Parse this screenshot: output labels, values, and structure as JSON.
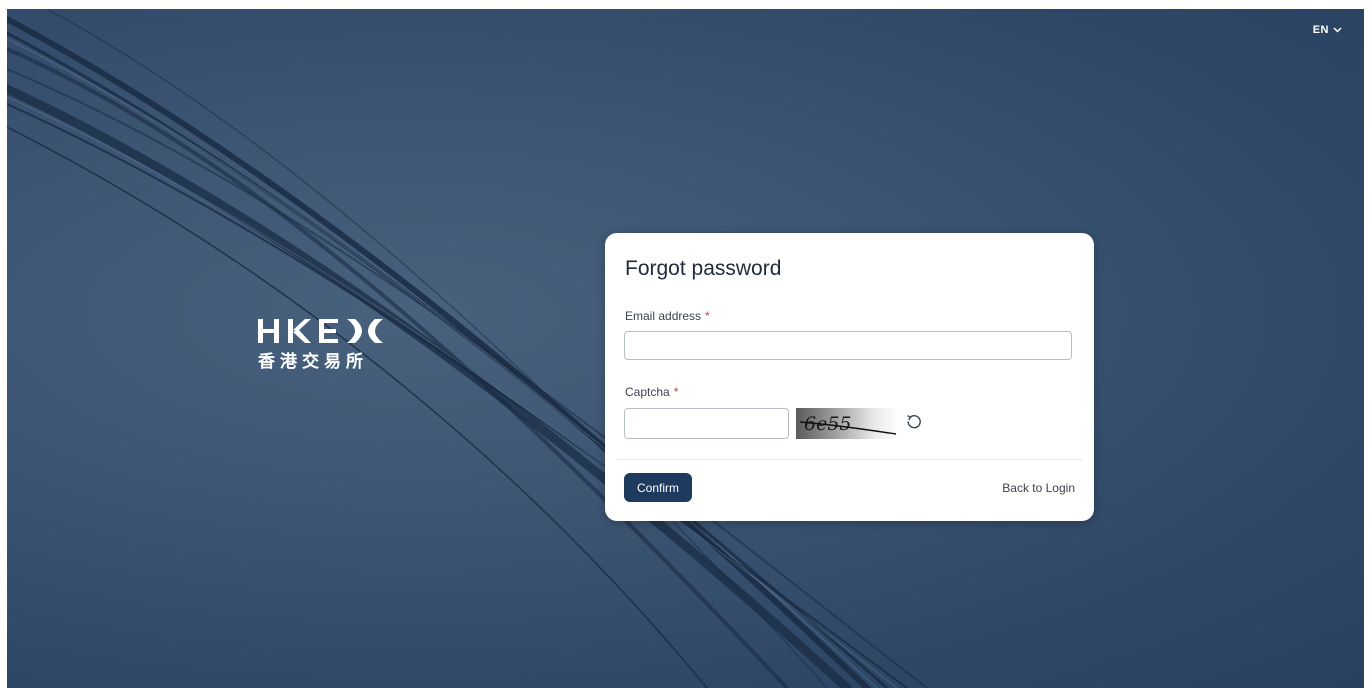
{
  "header": {
    "language": "EN"
  },
  "brand": {
    "logo_text": "HKEX",
    "logo_chinese": "香港交易所"
  },
  "form": {
    "title": "Forgot password",
    "email": {
      "label": "Email address",
      "required_mark": "*",
      "value": "",
      "placeholder": ""
    },
    "captcha": {
      "label": "Captcha",
      "required_mark": "*",
      "value": "",
      "placeholder": "",
      "image_text": "6e55"
    },
    "confirm_label": "Confirm",
    "back_label": "Back to Login"
  },
  "icons": {
    "language_caret": "chevron-down-icon",
    "captcha_refresh": "refresh-icon"
  },
  "colors": {
    "background": "#3d5674",
    "card": "#ffffff",
    "primary_button": "#1f3a5f",
    "required": "#d33a3a"
  }
}
